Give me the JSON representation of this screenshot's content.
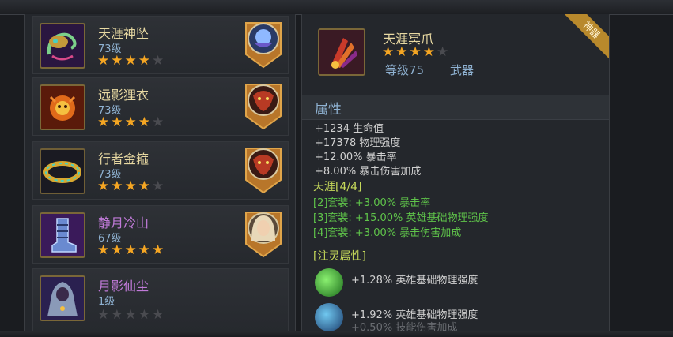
{
  "items": [
    {
      "name": "天涯神坠",
      "level": "73级",
      "stars_filled": 4,
      "stars_total": 5,
      "name_color": "gold",
      "icon": "pendant-icon",
      "badge": "hero-portrait-blue-icon"
    },
    {
      "name": "远影狸衣",
      "level": "73级",
      "stars_filled": 4,
      "stars_total": 5,
      "name_color": "gold",
      "icon": "armor-icon",
      "badge": "hero-portrait-beast-icon"
    },
    {
      "name": "行者金箍",
      "level": "73级",
      "stars_filled": 4,
      "stars_total": 5,
      "name_color": "gold",
      "icon": "ring-icon",
      "badge": "hero-portrait-beast-icon"
    },
    {
      "name": "静月冷山",
      "level": "67级",
      "stars_filled": 5,
      "stars_total": 5,
      "name_color": "purple",
      "icon": "boots-icon",
      "badge": "hero-portrait-woman-icon"
    },
    {
      "name": "月影仙尘",
      "level": "1级",
      "stars_filled": 0,
      "stars_total": 5,
      "name_color": "purple",
      "icon": "cloak-icon",
      "badge": ""
    }
  ],
  "detail": {
    "name": "天涯冥爪",
    "stars_filled": 4,
    "stars_total": 5,
    "level": "等级75",
    "type": "武器",
    "tag": "神器",
    "icon": "claw-icon",
    "section_title": "属性",
    "attributes": [
      "+1234 生命值",
      "+17378 物理强度",
      "+12.00% 暴击率",
      "+8.00% 暴击伤害加成"
    ],
    "set_title": "天涯[4/4]",
    "set_bonuses": [
      "[2]套装: +3.00% 暴击率",
      "[3]套装: +15.00% 英雄基础物理强度",
      "[4]套装: +3.00% 暴击伤害加成"
    ],
    "infuse_title": "[注灵属性]",
    "infusions": [
      {
        "text": "+1.28% 英雄基础物理强度",
        "orb": "green-orb-icon"
      },
      {
        "text": "+1.92% 英雄基础物理强度",
        "extra": "+0.50% 技能伤害加成",
        "orb": "blue-orb-icon"
      }
    ]
  },
  "colors": {
    "gold": "#e8d9a2",
    "purple": "#c07ad8",
    "star": "#f5a623",
    "green": "#5fc44a",
    "blue": "#8fb2d2"
  }
}
